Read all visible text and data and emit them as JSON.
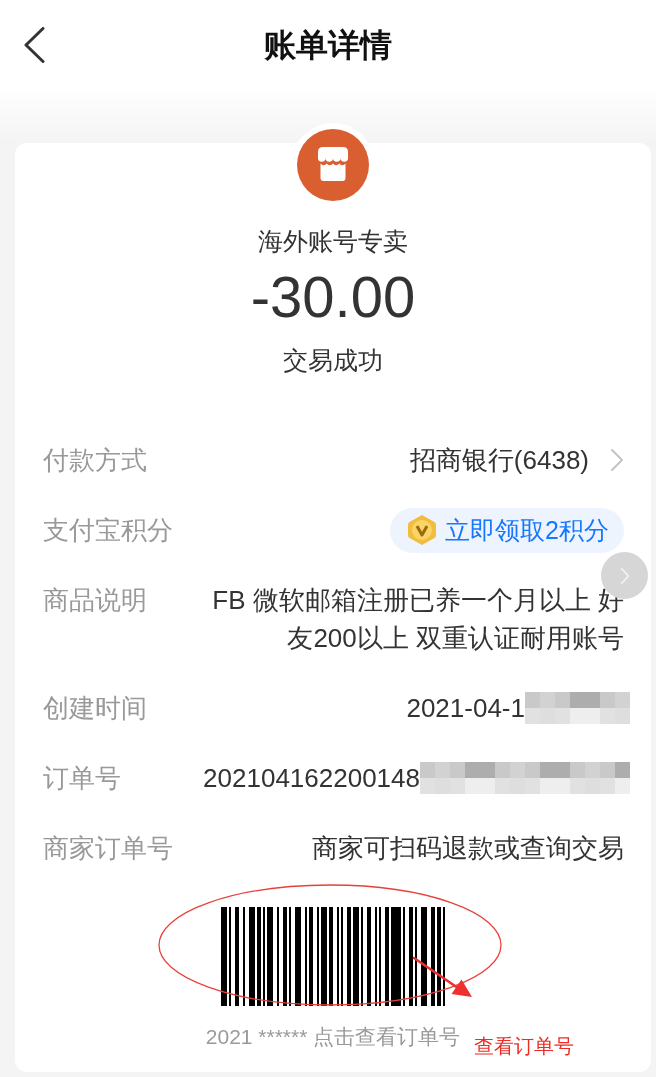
{
  "header": {
    "title": "账单详情"
  },
  "summary": {
    "merchant": "海外账号专卖",
    "amount": "-30.00",
    "status": "交易成功"
  },
  "details": [
    {
      "label": "付款方式",
      "value": "招商银行(6438)",
      "kind": "link"
    },
    {
      "label": "支付宝积分",
      "value": "立即领取2积分",
      "kind": "points"
    },
    {
      "label": "商品说明",
      "value": "FB 微软邮箱注册已养一个月以上 好友200以上 双重认证耐用账号",
      "kind": "text"
    },
    {
      "label": "创建时间",
      "value": "2021-04-1",
      "kind": "timestamp"
    },
    {
      "label": "订单号",
      "value": "202104162200148",
      "kind": "serial"
    },
    {
      "label": "商家订单号",
      "value": "商家可扫码退款或查询交易",
      "kind": "text"
    }
  ],
  "barcode": {
    "caption": "2021 ****** 点击查看订单号"
  },
  "annotation": {
    "label": "查看订单号"
  }
}
